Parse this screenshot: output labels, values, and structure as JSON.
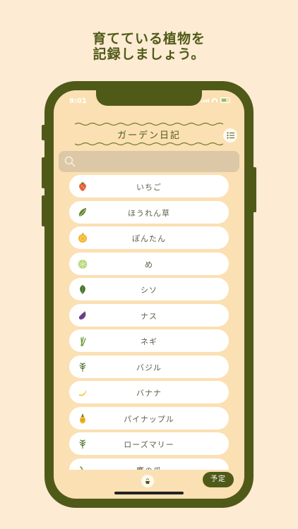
{
  "headline": {
    "line1": "育てている植物を",
    "line2": "記録しましょう。"
  },
  "status_bar": {
    "time": "9:01"
  },
  "app": {
    "title": "ガーデン日記"
  },
  "search": {
    "placeholder": ""
  },
  "plants": [
    {
      "name": "いちご",
      "icon": "strawberry-icon"
    },
    {
      "name": "ほうれん草",
      "icon": "spinach-icon"
    },
    {
      "name": "ぽんたん",
      "icon": "citrus-icon"
    },
    {
      "name": "め",
      "icon": "melon-icon"
    },
    {
      "name": "シソ",
      "icon": "shiso-leaf-icon"
    },
    {
      "name": "ナス",
      "icon": "eggplant-icon"
    },
    {
      "name": "ネギ",
      "icon": "green-onion-icon"
    },
    {
      "name": "バジル",
      "icon": "herb-sprig-icon"
    },
    {
      "name": "バナナ",
      "icon": "banana-icon"
    },
    {
      "name": "パイナップル",
      "icon": "pineapple-icon"
    },
    {
      "name": "ローズマリー",
      "icon": "herb-sprig-icon"
    },
    {
      "name": "鷹の爪",
      "icon": "chili-icon"
    }
  ],
  "bottom": {
    "schedule_label": "予定"
  },
  "colors": {
    "background": "#fdebd3",
    "phone_frame": "#4f5a19",
    "screen": "#fbe0b3",
    "row": "#ffffff",
    "accent": "#4f5a19"
  }
}
